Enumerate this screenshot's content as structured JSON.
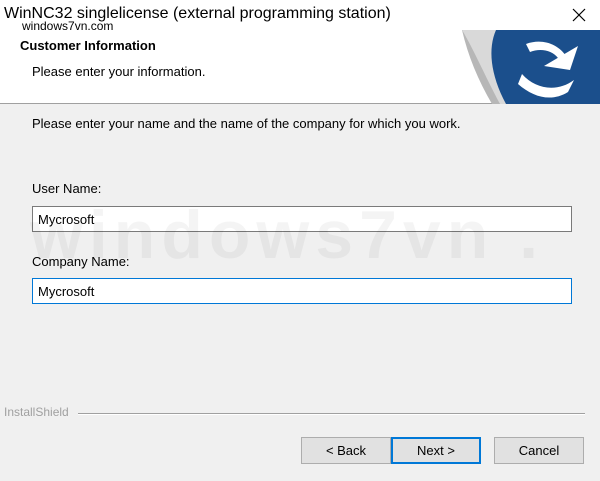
{
  "window": {
    "title": "WinNC32 singlelicense (external programming station)",
    "watermark_small": "windows7vn.com",
    "close_icon": "close-icon"
  },
  "header": {
    "title": "Customer Information",
    "subtitle": "Please enter your information.",
    "logo_icon": "installshield-page-curl-logo"
  },
  "body": {
    "instruction": "Please enter your name and the name of the company for which you work.",
    "user_name_label": "User Name:",
    "user_name_value": "Mycrosoft",
    "company_name_label": "Company Name:",
    "company_name_value": "Mycrosoft",
    "watermark": "windows7vn ."
  },
  "footer": {
    "installshield_label": "InstallShield",
    "back_label": "< Back",
    "next_label": "Next >",
    "cancel_label": "Cancel"
  },
  "colors": {
    "accent": "#0078d7",
    "logo_blue": "#1b4f8c",
    "background": "#f0f0f0"
  }
}
